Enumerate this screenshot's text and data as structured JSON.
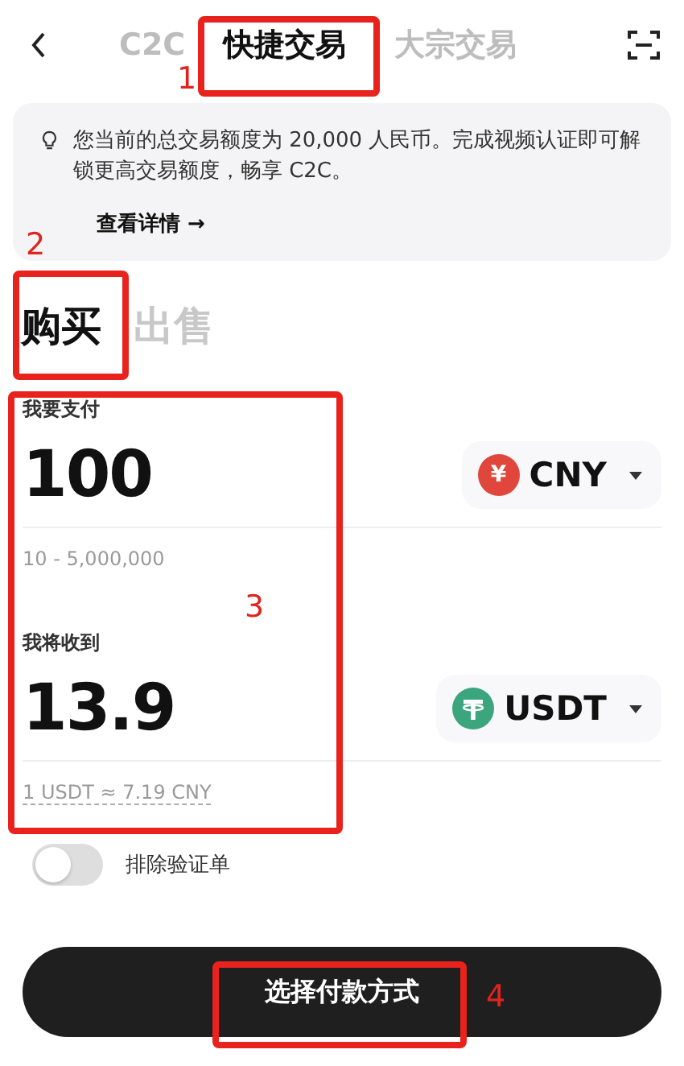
{
  "header": {
    "tabs": [
      {
        "label": "C2C",
        "selected": false
      },
      {
        "label": "快捷交易",
        "selected": true
      },
      {
        "label": "大宗交易",
        "selected": false
      }
    ]
  },
  "notice": {
    "text": "您当前的总交易额度为 20,000 人民币。完成视频认证即可解锁更高交易额度，畅享 C2C。",
    "link": "查看详情 →"
  },
  "side_tabs": [
    {
      "label": "购买",
      "selected": true
    },
    {
      "label": "出售",
      "selected": false
    }
  ],
  "amounts": [
    {
      "label": "我要支付",
      "value": "100",
      "coin": {
        "kind": "yuan",
        "symbol": "¥"
      },
      "code": "CNY",
      "hint": "10 - 5,000,000",
      "hint_underlined": false
    },
    {
      "label": "我将收到",
      "value": "13.9",
      "coin": {
        "kind": "tether"
      },
      "code": "USDT",
      "hint": "1 USDT ≈ 7.19 CNY",
      "hint_underlined": true
    }
  ],
  "exclude_toggle": {
    "label": "排除验证单",
    "on": false
  },
  "submit": "选择付款方式",
  "annotations": [
    {
      "label": "1"
    },
    {
      "label": "2"
    },
    {
      "label": "3"
    },
    {
      "label": "4"
    }
  ]
}
